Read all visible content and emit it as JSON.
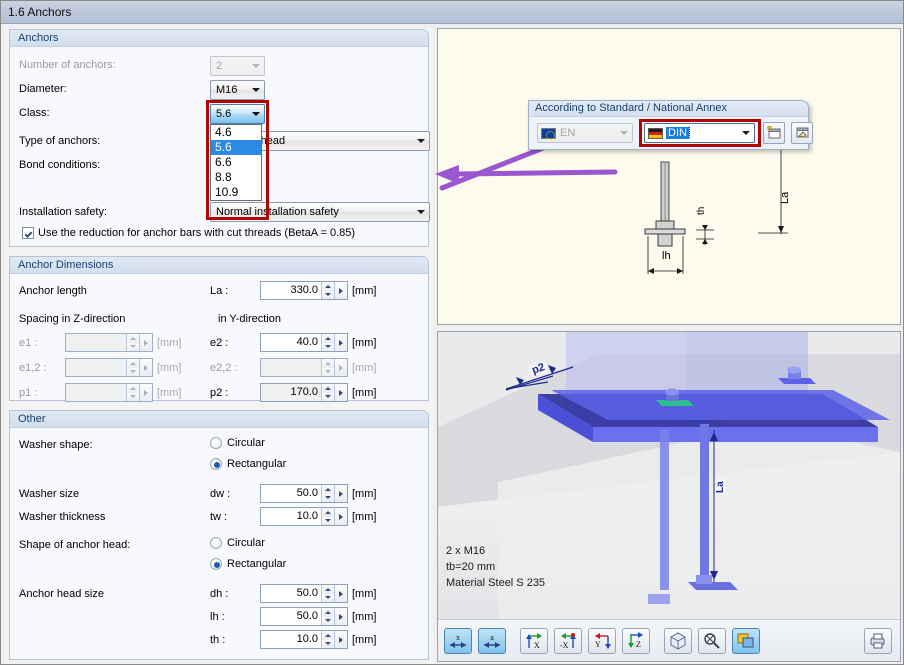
{
  "window": {
    "title": "1.6 Anchors"
  },
  "groups": {
    "anchors": {
      "title": "Anchors",
      "fields": {
        "number_label": "Number of anchors:",
        "number_value": "2",
        "diameter_label": "Diameter:",
        "diameter_value": "M16",
        "class_label": "Class:",
        "class_value": "5.6",
        "class_options": [
          "4.6",
          "5.6",
          "6.6",
          "8.8",
          "10.9"
        ],
        "class_selected_index": 1,
        "type_label": "Type of anchors:",
        "type_value": "Bolt with head",
        "bond_label": "Bond conditions:",
        "install_label": "Installation safety:",
        "install_value": "Normal installation safety",
        "reduction_checkbox": "Use the reduction for anchor bars with cut threads (BetaA = 0.85)",
        "reduction_checked": true
      }
    },
    "dimensions": {
      "title": "Anchor Dimensions",
      "anchor_length_label": "Anchor length",
      "anchor_length_symbol": "La :",
      "anchor_length_value": "330.0",
      "anchor_length_unit": "[mm]",
      "spacing_z_label": "Spacing in Z-direction",
      "spacing_y_label": "in Y-direction",
      "rows": [
        {
          "z_symbol": "e1 :",
          "z_value": "",
          "z_unit": "[mm]",
          "z_disabled": true,
          "y_symbol": "e2 :",
          "y_value": "40.0",
          "y_unit": "[mm]",
          "y_disabled": false
        },
        {
          "z_symbol": "e1,2 :",
          "z_value": "",
          "z_unit": "[mm]",
          "z_disabled": true,
          "y_symbol": "e2,2 :",
          "y_value": "",
          "y_unit": "[mm]",
          "y_disabled": true
        },
        {
          "z_symbol": "p1 :",
          "z_value": "",
          "z_unit": "[mm]",
          "z_disabled": true,
          "y_symbol": "p2 :",
          "y_value": "170.0",
          "y_unit": "[mm]",
          "y_disabled": false
        }
      ]
    },
    "other": {
      "title": "Other",
      "washer_shape_label": "Washer shape:",
      "washer_shape_options": [
        "Circular",
        "Rectangular"
      ],
      "washer_shape_selected": "Rectangular",
      "washer_size_label": "Washer size",
      "washer_size_symbol": "dw :",
      "washer_size_value": "50.0",
      "washer_size_unit": "[mm]",
      "washer_thickness_label": "Washer thickness",
      "washer_thickness_symbol": "tw :",
      "washer_thickness_value": "10.0",
      "washer_thickness_unit": "[mm]",
      "head_shape_label": "Shape of anchor head:",
      "head_shape_options": [
        "Circular",
        "Rectangular"
      ],
      "head_shape_selected": "Rectangular",
      "head_size_label": "Anchor head size",
      "head_rows": [
        {
          "symbol": "dh :",
          "value": "50.0",
          "unit": "[mm]"
        },
        {
          "symbol": "lh :",
          "value": "50.0",
          "unit": "[mm]"
        },
        {
          "symbol": "th :",
          "value": "10.0",
          "unit": "[mm]"
        }
      ]
    }
  },
  "standard_panel": {
    "title": "According to Standard / National Annex",
    "standard_value": "EN",
    "annex_value": "DIN",
    "new_button_tip": "New",
    "edit_button_tip": "Edit"
  },
  "view_2d": {
    "dim_lh": "lh",
    "dim_th": "th",
    "dim_La": "La"
  },
  "view_3d": {
    "dim_p2": "p2",
    "dim_La": "La",
    "annotations": [
      "2 x M16",
      "tb=20 mm",
      "Material Steel S 235"
    ]
  },
  "toolbar_3d": {
    "buttons": [
      {
        "name": "dimension-x-button",
        "label": "x",
        "active": true
      },
      {
        "name": "dimension-a-button",
        "label": "a",
        "active": true
      },
      {
        "name": "view-x-button",
        "label": "X",
        "active": false
      },
      {
        "name": "view-negx-button",
        "label": "-X",
        "active": false
      },
      {
        "name": "view-y-button",
        "label": "Y",
        "active": false
      },
      {
        "name": "view-z-button",
        "label": "Z",
        "active": false
      },
      {
        "name": "isometric-view-button",
        "label": "",
        "active": false
      },
      {
        "name": "zoom-all-button",
        "label": "",
        "active": false
      },
      {
        "name": "render-mode-button",
        "label": "",
        "active": true
      }
    ],
    "print_button": "print-icon"
  },
  "colors": {
    "accent_blue": "#1c7fe0",
    "highlight_red": "#b00505",
    "arrow_purple": "#9a57cf",
    "group_title": "#19406e",
    "view2d_bg": "#fdfaee"
  }
}
